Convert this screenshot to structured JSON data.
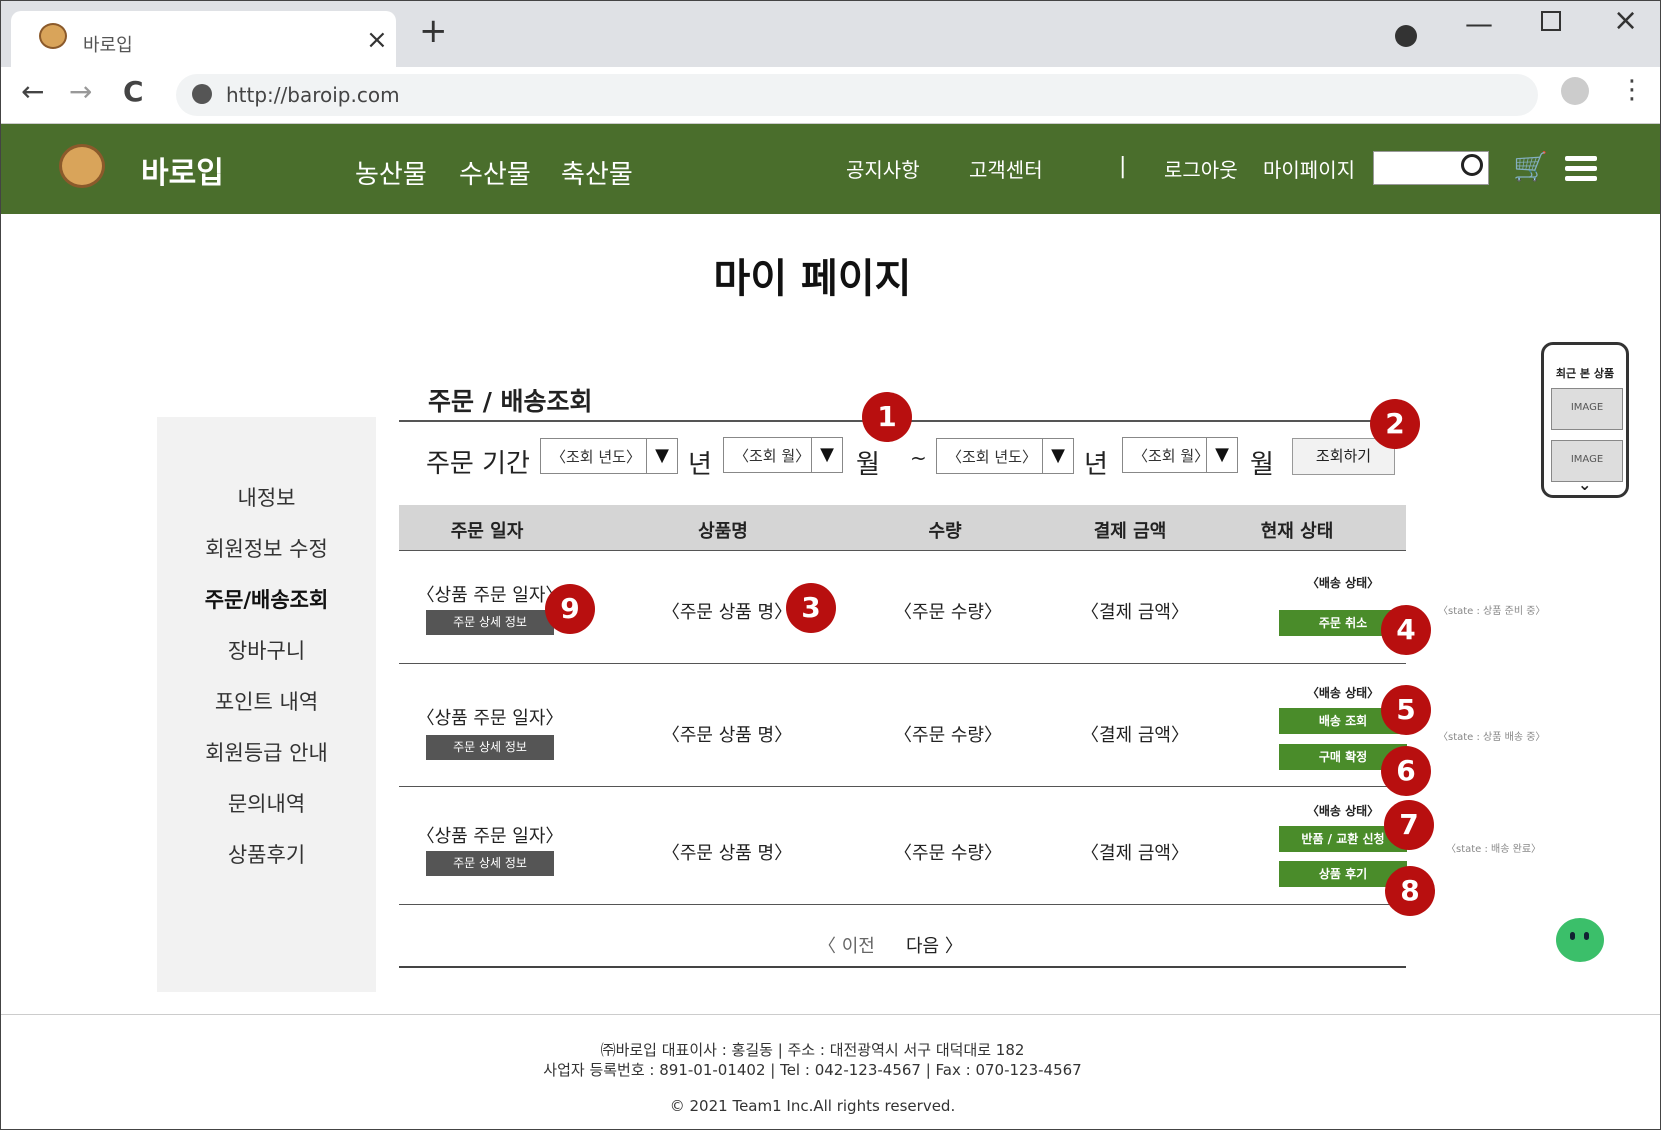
{
  "browser": {
    "tab_title": "바로입",
    "tab_close": "×",
    "new_tab": "+",
    "url": "http://baroip.com",
    "nav_back": "←",
    "nav_forward": "→",
    "nav_reload": "C",
    "menu": "⋮",
    "window_min": "—",
    "window_close": "×"
  },
  "header": {
    "brand": "바로입",
    "categories": [
      "농산물",
      "수산물",
      "축산물"
    ],
    "links": [
      "공지사항",
      "고객센터"
    ],
    "separator": "|",
    "user_links": [
      "로그아웃",
      "마이페이지"
    ],
    "colors": {
      "header_bg": "#4a6e2c",
      "button_green": "#4a8c2a",
      "badge_red": "#b80f0f"
    }
  },
  "page": {
    "title": "마이 페이지"
  },
  "sidebar": {
    "items": [
      {
        "label": "내정보",
        "active": false
      },
      {
        "label": "회원정보 수정",
        "active": false
      },
      {
        "label": "주문/배송조회",
        "active": true
      },
      {
        "label": "장바구니",
        "active": false
      },
      {
        "label": "포인트 내역",
        "active": false
      },
      {
        "label": "회원등급 안내",
        "active": false
      },
      {
        "label": "문의내역",
        "active": false
      },
      {
        "label": "상품후기",
        "active": false
      }
    ]
  },
  "orders": {
    "section_title": "주문 / 배송조회",
    "filter": {
      "label": "주문 기간",
      "from_year": "〈조회 년도〉",
      "from_month": "〈조회 월〉",
      "to_year": "〈조회 년도〉",
      "to_month": "〈조회 월〉",
      "year_unit": "년",
      "month_unit": "월",
      "tilde": "~",
      "submit": "조회하기"
    },
    "columns": [
      "주문 일자",
      "상품명",
      "수량",
      "결제 금액",
      "현재 상태"
    ],
    "rows": [
      {
        "date": "〈상품 주문 일자〉",
        "detail": "주문 상세 정보",
        "product": "〈주문 상품 명〉",
        "qty": "〈주문 수량〉",
        "amount": "〈결제 금액〉",
        "status_label": "〈배송 상태〉",
        "buttons": [
          "주문 취소"
        ],
        "state_note": "〈state : 상품 준비 중〉"
      },
      {
        "date": "〈상품 주문 일자〉",
        "detail": "주문 상세 정보",
        "product": "〈주문 상품 명〉",
        "qty": "〈주문 수량〉",
        "amount": "〈결제 금액〉",
        "status_label": "〈배송 상태〉",
        "buttons": [
          "배송 조회",
          "구매 확정"
        ],
        "state_note": "〈state : 상품 배송 중〉"
      },
      {
        "date": "〈상품 주문 일자〉",
        "detail": "주문 상세 정보",
        "product": "〈주문 상품 명〉",
        "qty": "〈주문 수량〉",
        "amount": "〈결제 금액〉",
        "status_label": "〈배송 상태〉",
        "buttons": [
          "반품 / 교환 신청",
          "상품 후기"
        ],
        "state_note": "〈state : 배송 완료〉"
      }
    ],
    "pager": {
      "prev": "〈 이전",
      "next": "다음 〉"
    }
  },
  "annotations": [
    "1",
    "2",
    "3",
    "4",
    "5",
    "6",
    "7",
    "8",
    "9"
  ],
  "recent": {
    "title": "최근 본 상품",
    "images": [
      "IMAGE",
      "IMAGE"
    ],
    "chevron": "⌄"
  },
  "footer": {
    "line1": "㈜바로입 대표이사 : 홍길동 | 주소 : 대전광역시 서구 대덕대로 182",
    "line2": "사업자 등록번호 : 891-01-01402 | Tel : 042-123-4567 | Fax : 070-123-4567",
    "copyright": "© 2021 Team1 Inc.All rights reserved."
  },
  "icons": [
    "logo-icon",
    "search-icon",
    "cart-icon",
    "hamburger-icon",
    "chat-icon",
    "globe-icon",
    "profile-icon"
  ]
}
